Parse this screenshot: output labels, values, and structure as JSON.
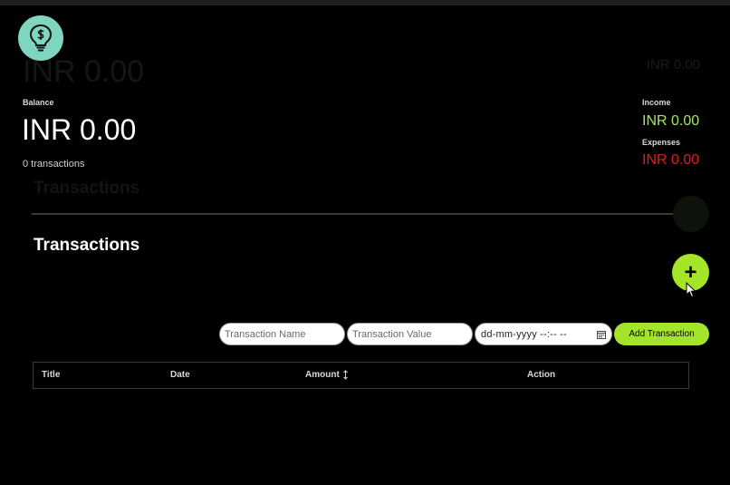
{
  "summary": {
    "ghost_balance": "INR 0.00",
    "ghost_right": "INR 0.00",
    "balance_label": "Balance",
    "balance_value": "INR 0.00",
    "transaction_count": "0 transactions",
    "income_label": "Income",
    "income_value": "INR 0.00",
    "expenses_label": "Expenses",
    "expenses_value": "INR 0.00"
  },
  "colors": {
    "accent": "#a4e52a",
    "income": "#a4e85a",
    "expenses": "#e01d1d",
    "logo_bg": "#7fd6c0",
    "background": "#000000"
  },
  "transactions": {
    "ghost_title": "Transactions",
    "title": "Transactions",
    "add_fab_label": "+",
    "form": {
      "name_placeholder": "Transaction Name",
      "value_placeholder": "Transaction Value",
      "date_placeholder": "dd-mm-yyyy --:-- --",
      "submit_label": "Add Transaction"
    },
    "table": {
      "columns": [
        "Title",
        "Date",
        "Amount",
        "Action"
      ],
      "rows": []
    }
  },
  "icons": {
    "logo": "lightbulb-dollar-icon",
    "calendar": "calendar-icon",
    "sort": "sort-arrows-icon",
    "cursor": "mouse-cursor-icon"
  }
}
